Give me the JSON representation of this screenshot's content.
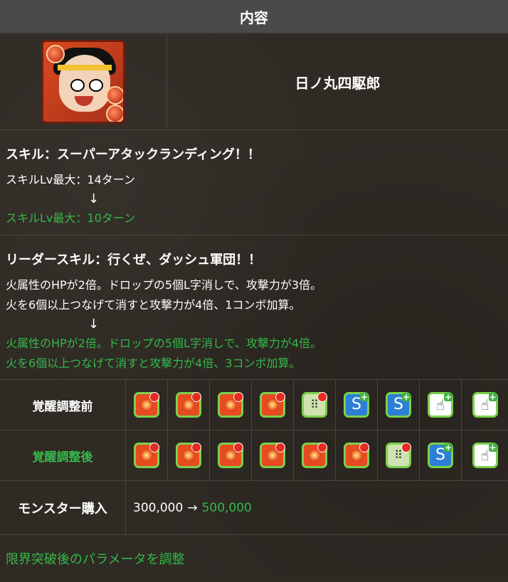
{
  "header": {
    "title": "内容"
  },
  "monster": {
    "name": "日ノ丸四駆郎"
  },
  "skill": {
    "title": "スキル：スーパーアタックランディング！！",
    "before": "スキルLv最大：14ターン",
    "arrow": "↓",
    "after": "スキルLv最大：10ターン"
  },
  "leader_skill": {
    "title": "リーダースキル：行くぜ、ダッシュ軍団！！",
    "before_line1": "火属性のHPが2倍。ドロップの5個L字消しで、攻撃力が3倍。",
    "before_line2": "火を6個以上つなげて消すと攻撃力が4倍、1コンボ加算。",
    "arrow": "↓",
    "after_line1": "火属性のHPが2倍。ドロップの5個L字消しで、攻撃力が4倍。",
    "after_line2": "火を6個以上つなげて消すと攻撃力が4倍、3コンボ加算。"
  },
  "awakenings": {
    "before_label": "覚醒調整前",
    "after_label": "覚醒調整後",
    "before": [
      "fire-enhance-icon",
      "fire-enhance-icon",
      "fire-enhance-icon",
      "fire-enhance-icon",
      "l-shape-attack-icon",
      "move-time-extend-icon",
      "move-time-extend-icon",
      "finger-extend-icon",
      "finger-extend-icon"
    ],
    "after": [
      "fire-enhance-icon",
      "fire-enhance-icon",
      "fire-enhance-icon",
      "fire-enhance-icon",
      "fire-enhance-icon",
      "fire-enhance-icon",
      "l-shape-attack-icon",
      "move-time-extend-plus-icon",
      "finger-extend-plus-icon"
    ]
  },
  "purchase": {
    "label": "モンスター購入",
    "before": "300,000",
    "arrow": "→",
    "after": "500,000"
  },
  "limit_break": {
    "link_text": "限界突破後のパラメータを調整"
  },
  "colors": {
    "green": "#34b84a",
    "header_bg": "#4a4a4a",
    "bg": "#2f2a24"
  }
}
